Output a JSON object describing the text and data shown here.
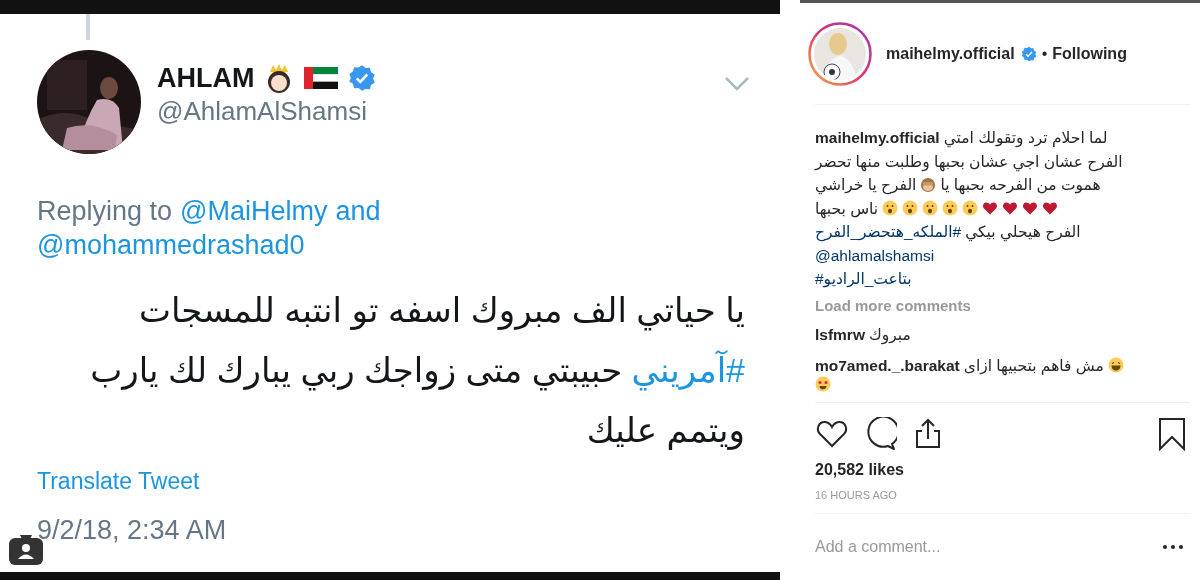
{
  "tweet": {
    "name": "AHLAM",
    "handle": "@AhlamAlShamsi",
    "replying_label": "Replying to",
    "replying_to": {
      "first_mention": "@MaiHelmy",
      "conjunction": "and",
      "second_mention": "@mohammedrashad0"
    },
    "body_lines": [
      [
        {
          "kind": "text",
          "text": "يا حياتي الف مبروك اسفه تو انتبه للمسجات"
        }
      ],
      [
        {
          "kind": "hashtag",
          "text": "#آمريني"
        },
        {
          "kind": "text",
          "text": " حبيبتي متى زواجك ربي يبارك لك يارب"
        }
      ],
      [
        {
          "kind": "text",
          "text": "ويتمم عليك"
        }
      ]
    ],
    "translate": "Translate Tweet",
    "timestamp": "9/2/18, 2:34 AM"
  },
  "post": {
    "username": "maihelmy.official",
    "separator": "•",
    "follow_status": "Following",
    "caption_lines": [
      [
        {
          "kind": "text",
          "text": "لما احلام ترد وتقولك امتي"
        },
        {
          "kind": "username",
          "text": "maihelmy.official"
        }
      ],
      [
        {
          "kind": "text",
          "text": "الفرح عشان اجي عشان بحبها وطلبت منها تحضر"
        }
      ],
      [
        {
          "kind": "text",
          "text": "هموت من الفرحه بحبها يا"
        },
        {
          "kind": "monkey"
        },
        {
          "kind": "text",
          "text": "الفرح يا خراشي"
        }
      ],
      [
        {
          "kind": "heart"
        },
        {
          "kind": "heart"
        },
        {
          "kind": "heart"
        },
        {
          "kind": "heart"
        },
        {
          "kind": "wow"
        },
        {
          "kind": "wow"
        },
        {
          "kind": "wow"
        },
        {
          "kind": "wow"
        },
        {
          "kind": "wow"
        },
        {
          "kind": "text",
          "text": "ناس بحبها"
        }
      ],
      [
        {
          "kind": "text",
          "text": "الفرح هيحلي بيكي"
        },
        {
          "kind": "hashtag",
          "text": "#الملكه_هتحضر_الفرح"
        }
      ],
      [
        {
          "kind": "hashtag",
          "text": "@ahlamalshamsi"
        }
      ],
      [
        {
          "kind": "hashtag",
          "text": "بتاعت_الراديو#"
        }
      ]
    ],
    "load_more": "Load more comments",
    "comments": [
      {
        "user": "lsfmrw",
        "lines": [
          [
            {
              "kind": "text",
              "text": "مبروك"
            }
          ]
        ]
      },
      {
        "user": "mo7amed._.barakat",
        "lines": [
          [
            {
              "kind": "laugh"
            },
            {
              "kind": "text",
              "text": "مش فاهم بتحبيها ازاى"
            }
          ],
          [
            {
              "kind": "love"
            }
          ]
        ]
      }
    ],
    "likes": "20,582 likes",
    "time_ago": "16 HOURS AGO",
    "comment_placeholder": "Add a comment..."
  }
}
